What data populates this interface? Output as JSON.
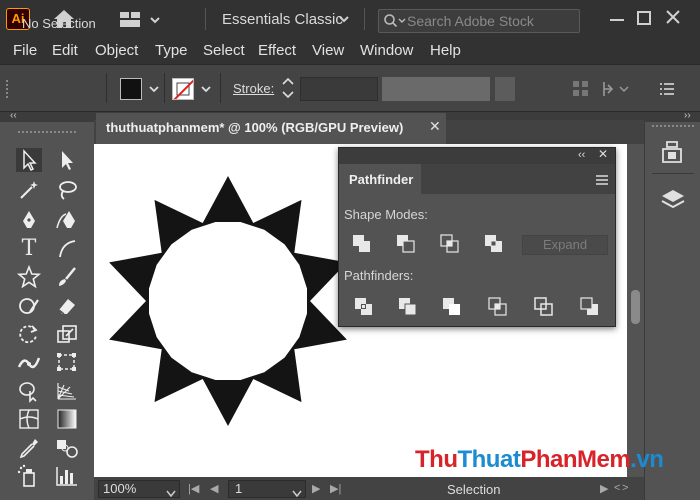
{
  "app": {
    "logo": "Ai",
    "workspace": "Essentials Classic",
    "stock_placeholder": "Search Adobe Stock"
  },
  "menu": [
    "File",
    "Edit",
    "Object",
    "Type",
    "Select",
    "Effect",
    "View",
    "Window",
    "Help"
  ],
  "control_bar": {
    "selection_status": "No Selection",
    "stroke_label": "Stroke:"
  },
  "document": {
    "tab_title": "thuthuatphanmem* @ 100% (RGB/GPU Preview)",
    "close_glyph": "✕"
  },
  "status_bar": {
    "zoom": "100%",
    "page": "1",
    "tool": "Selection"
  },
  "pathfinder": {
    "tab": "Pathfinder",
    "shape_modes_label": "Shape Modes:",
    "pathfinders_label": "Pathfinders:",
    "expand_label": "Expand"
  },
  "watermark": {
    "part1": "Thu",
    "part2": "Thuat",
    "part3": "PhanMem",
    "part4": ".vn"
  },
  "colors": {
    "accent": "#ff9a00",
    "canvas": "#ffffff",
    "star": "#141414"
  },
  "icons": {
    "home": "home-icon",
    "layout": "layout-icon",
    "search": "search-icon"
  }
}
